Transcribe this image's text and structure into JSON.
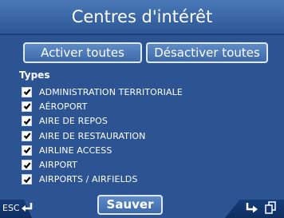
{
  "header": {
    "title": "Centres d'intérêt"
  },
  "buttons": {
    "activate_all": "Activer toutes",
    "deactivate_all": "Désactiver toutes",
    "save": "Sauver",
    "esc": "ESC"
  },
  "list": {
    "heading": "Types",
    "items": [
      {
        "label": "ADMINISTRATION TERRITORIALE",
        "checked": true
      },
      {
        "label": "AÉROPORT",
        "checked": true
      },
      {
        "label": "AIRE DE REPOS",
        "checked": true
      },
      {
        "label": "AIRE DE RESTAURATION",
        "checked": true
      },
      {
        "label": "AIRLINE ACCESS",
        "checked": true
      },
      {
        "label": "AIRPORT",
        "checked": true
      },
      {
        "label": "AIRPORTS / AIRFIELDS",
        "checked": true
      }
    ]
  },
  "icons": {
    "back": "back-arrow-icon",
    "next": "next-arrow-icon",
    "copy": "copy-icon"
  },
  "colors": {
    "background": "#2c5492",
    "title_bar": "#3c67a6",
    "button": "#4f7dbb",
    "button_border": "#dfe8f5",
    "tab": "#133670",
    "text": "#ffffff"
  }
}
